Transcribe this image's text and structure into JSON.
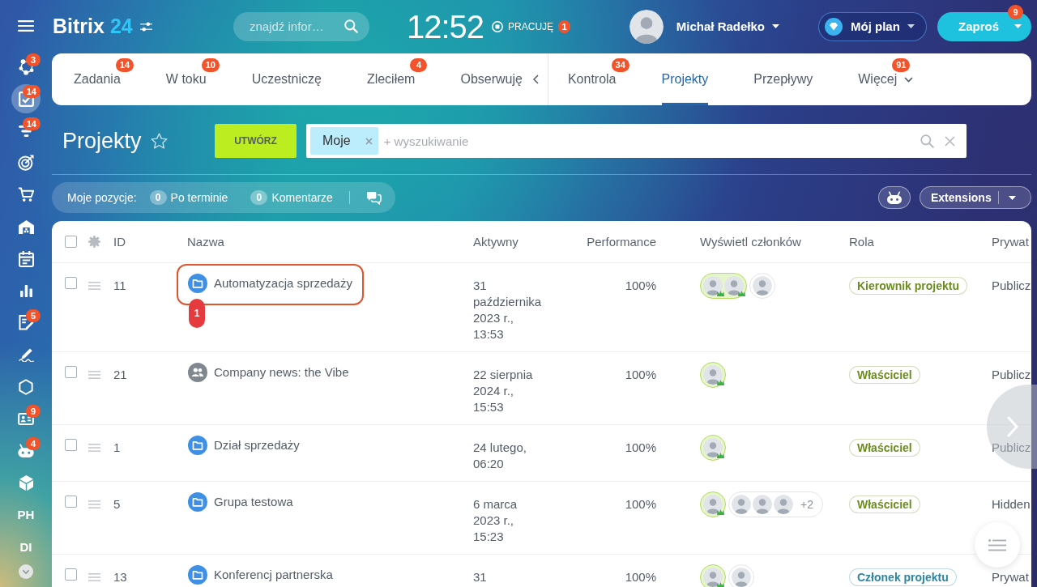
{
  "sidebar": {
    "items": [
      {
        "kind": "icon",
        "badge": "3",
        "selected": false
      },
      {
        "kind": "icon",
        "badge": "14",
        "selected": true
      },
      {
        "kind": "icon",
        "badge": "14",
        "selected": false
      },
      {
        "kind": "icon",
        "selected": false
      },
      {
        "kind": "icon",
        "selected": false
      },
      {
        "kind": "icon",
        "selected": false
      },
      {
        "kind": "icon",
        "selected": false
      },
      {
        "kind": "icon",
        "selected": false
      },
      {
        "kind": "icon",
        "badge": "5",
        "selected": false
      },
      {
        "kind": "icon",
        "selected": false
      },
      {
        "kind": "icon",
        "selected": false
      },
      {
        "kind": "icon",
        "badge": "9",
        "selected": false
      },
      {
        "kind": "icon",
        "badge": "4",
        "selected": false
      },
      {
        "kind": "icon",
        "selected": false
      },
      {
        "kind": "text",
        "label": "PH",
        "selected": false
      },
      {
        "kind": "text",
        "label": "DI",
        "selected": false
      },
      {
        "kind": "more",
        "selected": false
      }
    ]
  },
  "header": {
    "logo": {
      "wordmark": "Bitrix",
      "number": "24"
    },
    "search": {
      "placeholder": "znajdź infor…"
    },
    "clock": "12:52",
    "work_status": {
      "label": "PRACUJĘ",
      "badge": "1"
    },
    "user": {
      "name": "Michał Radełko"
    },
    "plan_button": {
      "label": "Mój plan"
    },
    "invite_button": {
      "label": "Zaproś",
      "badge": "9"
    }
  },
  "tabs": {
    "primary": [
      {
        "kind": "tab",
        "label": "Zadania",
        "badge": "14",
        "selected": false
      },
      {
        "kind": "tab",
        "label": "W toku",
        "badge": "10",
        "selected": false
      },
      {
        "kind": "tab",
        "label": "Uczestniczę",
        "selected": false
      },
      {
        "kind": "tab",
        "label": "Zleciłem",
        "badge": "4",
        "selected": false
      },
      {
        "kind": "tab",
        "label": "Obserwuję",
        "selected": false
      }
    ],
    "secondary": [
      {
        "kind": "tab",
        "label": "Kontrola",
        "badge": "34",
        "selected": false
      },
      {
        "kind": "tab",
        "label": "Projekty",
        "selected": true
      },
      {
        "kind": "tab",
        "label": "Przepływy",
        "selected": false
      },
      {
        "kind": "dropdown",
        "label": "Więcej",
        "badge": "91",
        "selected": false
      }
    ]
  },
  "page": {
    "title": "Projekty",
    "favorite": false,
    "create_button": "UTWÓRZ",
    "filter": {
      "tags": [
        {
          "label": "Moje"
        }
      ],
      "placeholder": "+ wyszukiwanie"
    }
  },
  "counters": {
    "label": "Moje pozycje:",
    "items": [
      {
        "count": "0",
        "label": "Po terminie"
      },
      {
        "count": "0",
        "label": "Komentarze"
      }
    ]
  },
  "toolbar": {
    "extensions_button": "Extensions"
  },
  "table": {
    "select_all": false,
    "columns": [
      "ID",
      "Nazwa",
      "Aktywny",
      "Performance",
      "Wyświetl członków",
      "Rola",
      "Prywat"
    ],
    "rows": [
      {
        "checked": false,
        "highlighted": true,
        "marker": "1",
        "id": "11",
        "kind": "project",
        "name": "Automatyzacja sprzedaży",
        "active": "31 października 2023 r., 13:53",
        "performance": "100%",
        "members": [
          {
            "kind": "owner"
          },
          {
            "kind": "owner"
          },
          {
            "kind": "member"
          }
        ],
        "role": {
          "label": "Kierownik projektu",
          "color": "#6a8d1e"
        },
        "privacy": "Publicz"
      },
      {
        "checked": false,
        "highlighted": false,
        "id": "21",
        "kind": "group",
        "name": "Company news: the Vibe",
        "active": "22 sierpnia 2024 r., 15:53",
        "performance": "100%",
        "members": [
          {
            "kind": "owner"
          }
        ],
        "role": {
          "label": "Właściciel",
          "color": "#6a8d1e"
        },
        "privacy": "Publicz"
      },
      {
        "checked": false,
        "highlighted": false,
        "id": "1",
        "kind": "project",
        "name": "Dział sprzedaży",
        "active": "24 lutego, 06:20",
        "performance": "100%",
        "members": [
          {
            "kind": "owner"
          }
        ],
        "role": {
          "label": "Właściciel",
          "color": "#6a8d1e"
        },
        "privacy": "Publicz"
      },
      {
        "checked": false,
        "highlighted": false,
        "id": "5",
        "kind": "project",
        "name": "Grupa testowa",
        "active": "6 marca 2023 r., 15:23",
        "performance": "100%",
        "members": [
          {
            "kind": "owner"
          },
          {
            "kind": "member"
          },
          {
            "kind": "member"
          },
          {
            "kind": "member"
          }
        ],
        "more_members": "+2",
        "role": {
          "label": "Właściciel",
          "color": "#6a8d1e"
        },
        "privacy": "Hidden"
      },
      {
        "checked": false,
        "highlighted": false,
        "id": "13",
        "kind": "project",
        "name": "Konferencj partnerska",
        "active": "31",
        "performance": "100%",
        "members": [
          {
            "kind": "owner"
          },
          {
            "kind": "member"
          }
        ],
        "role": {
          "label": "Członek projektu",
          "color": "#2b86a6"
        },
        "privacy": "Prywat"
      }
    ]
  }
}
